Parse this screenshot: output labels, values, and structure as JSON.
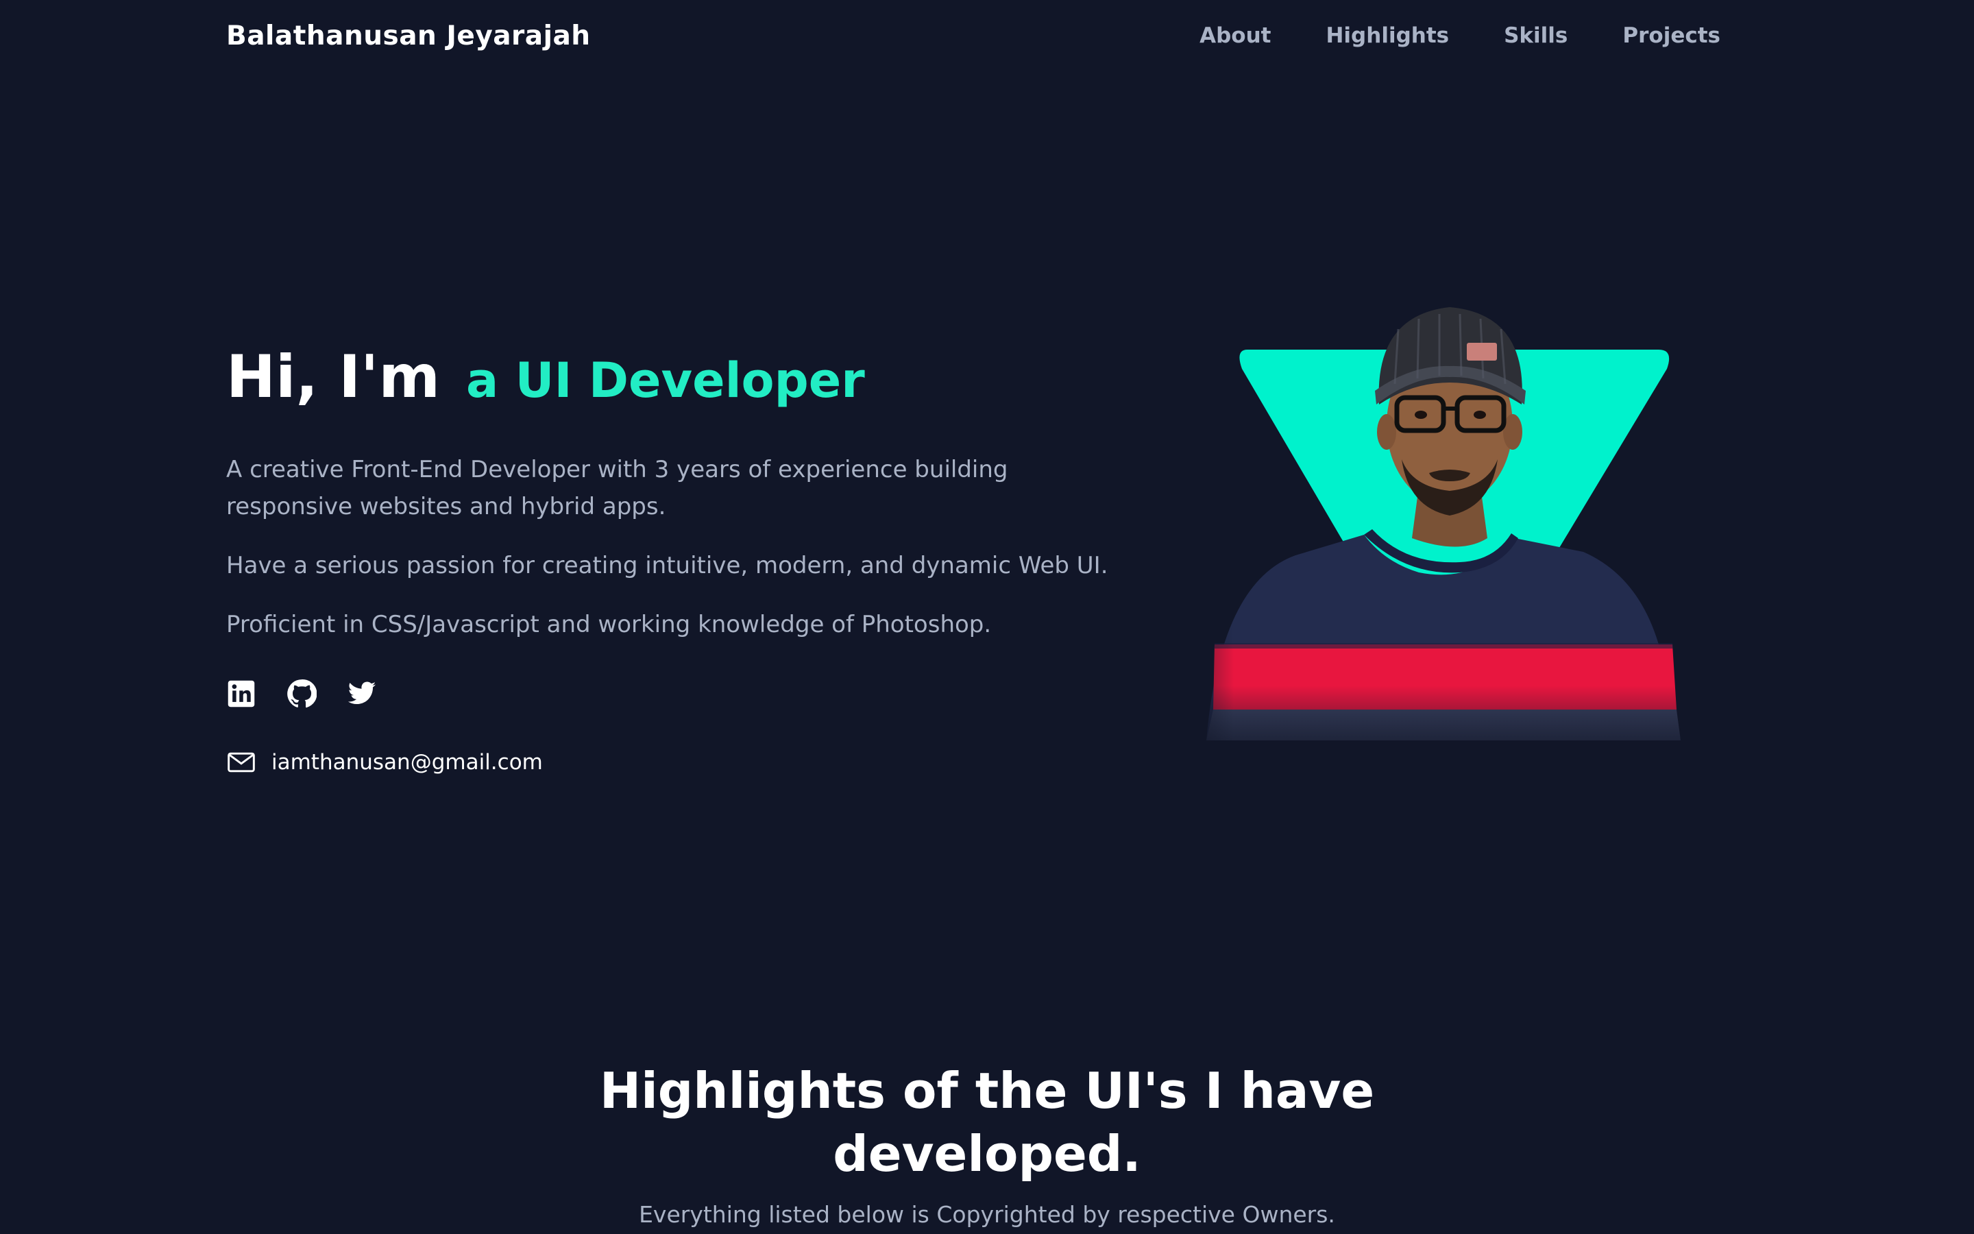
{
  "nav": {
    "brand": "Balathanusan Jeyarajah",
    "links": [
      "About",
      "Highlights",
      "Skills",
      "Projects"
    ]
  },
  "hero": {
    "greeting": "Hi, I'm",
    "role": "a UI Developer",
    "paragraphs": [
      "A creative Front-End Developer with 3 years of experience building responsive websites and hybrid apps.",
      "Have a serious passion for creating intuitive, modern, and dynamic Web UI.",
      "Proficient in CSS/Javascript and working knowledge of Photoshop."
    ],
    "socials": [
      "linkedin-icon",
      "github-icon",
      "twitter-icon"
    ],
    "email": "iamthanusan@gmail.com"
  },
  "highlights": {
    "title": "Highlights of the UI's I have developed.",
    "subtitle": "Everything listed below is Copyrighted by respective Owners."
  },
  "colors": {
    "background": "#111628",
    "accent": "#22edc4",
    "muted_text": "#aab3c6",
    "shirt_red": "#e8163f",
    "shirt_navy": "#232c4e"
  }
}
